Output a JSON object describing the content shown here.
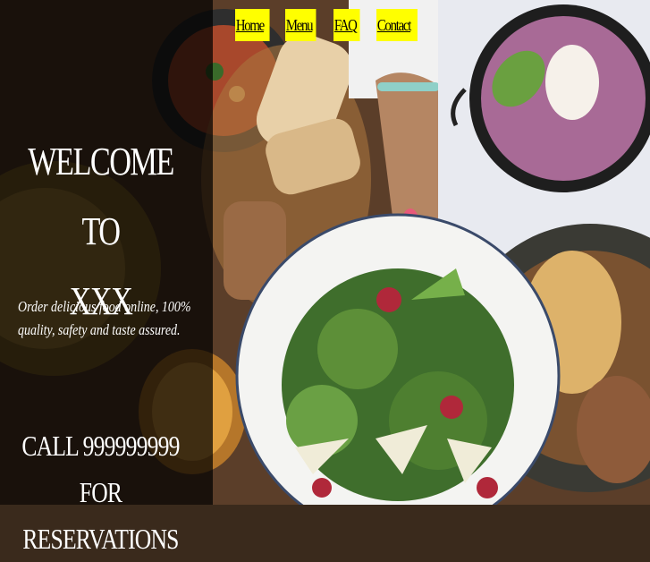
{
  "nav": {
    "home": "Home",
    "menu": "Menu",
    "faq": "FAQ",
    "contact": "Contact"
  },
  "hero": {
    "welcome_line1": "WELCOME TO",
    "welcome_line2": "XXX",
    "tagline": "Order delicious food online, 100% quality, safety and taste assured.",
    "call_line1": "CALL 999999999 FOR",
    "call_line2": "RESERVATIONS"
  },
  "colors": {
    "nav_bg": "#ffff00",
    "panel_overlay": "rgba(0,0,0,0.72)",
    "text": "#ffffff"
  }
}
